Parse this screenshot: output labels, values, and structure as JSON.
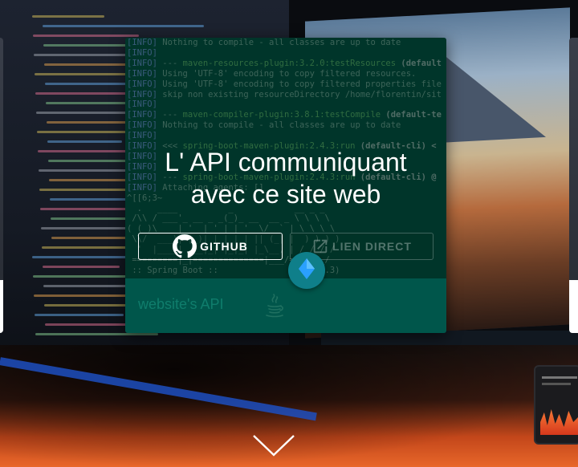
{
  "hero": {
    "title_line1": "L' API communiquant",
    "title_line2": "avec ce site web"
  },
  "card": {
    "terminal_lines": [
      {
        "tag": "[INFO]",
        "text": " Nothing to compile - all classes are up to date"
      },
      {
        "tag": "[INFO]",
        "text": ""
      },
      {
        "tag": "[INFO]",
        "text": " --- ",
        "plugin": "maven-resources-plugin:3.2.0:testResources",
        "goal": " (default"
      },
      {
        "tag": "[INFO]",
        "text": " Using 'UTF-8' encoding to copy filtered resources."
      },
      {
        "tag": "[INFO]",
        "text": " Using 'UTF-8' encoding to copy filtered properties file"
      },
      {
        "tag": "[INFO]",
        "text": " skip non existing resourceDirectory /home/florentin/sit"
      },
      {
        "tag": "[INFO]",
        "text": ""
      },
      {
        "tag": "[INFO]",
        "text": " --- ",
        "plugin": "maven-compiler-plugin:3.8.1:testCompile",
        "goal": " (default-te"
      },
      {
        "tag": "[INFO]",
        "text": " Nothing to compile - all classes are up to date"
      },
      {
        "tag": "[INFO]",
        "text": ""
      },
      {
        "tag": "[INFO]",
        "text": " <<< ",
        "plugin": "spring-boot-maven-plugin:2.4.3:run",
        "goal": " (default-cli) <"
      },
      {
        "tag": "[INFO]",
        "text": ""
      },
      {
        "tag": "[INFO]",
        "text": ""
      },
      {
        "tag": "[INFO]",
        "text": " --- ",
        "plugin": "spring-boot-maven-plugin:2.4.3:run",
        "goal": " (default-cli) @"
      },
      {
        "tag": "[INFO]",
        "text": " Attaching agents: []"
      },
      {
        "tag": "",
        "text": "^[[6;3~"
      },
      {
        "tag": "",
        "text": "  .   ____          _            __ _ _"
      },
      {
        "tag": "",
        "text": " /\\\\ / ___'_ __ _ _(_)_ __  __ _ \\ \\ \\ \\"
      },
      {
        "tag": "",
        "text": "( ( )\\___ | '_ | '_| | '_ \\/ _` | \\ \\ \\ \\"
      },
      {
        "tag": "",
        "text": " \\\\/  ___)| |_)| | | | | || (_| |  ) ) ) )"
      },
      {
        "tag": "",
        "text": "  '  |____| .__|_| |_|_| |_\\__, | / / / /"
      },
      {
        "tag": "",
        "text": " =========|_|==============|___/=/_/_/_/"
      },
      {
        "tag": "",
        "text": " :: Spring Boot ::                (v2.4.3)"
      }
    ],
    "github_label": "GITHUB",
    "direct_label": "LIEN DIRECT",
    "footer_label": "website's API"
  },
  "icons": {
    "github": "github-icon",
    "external_link": "external-link-icon",
    "java": "java-icon",
    "diamond": "diamond-icon",
    "scroll_down": "chevron-down-icon"
  },
  "colors": {
    "terminal_bg": "#00372c",
    "footer_bg": "#00564b",
    "footer_text": "#0f7d6c",
    "fab": "#0f7f8a",
    "fab_icon": "#2aa0ff"
  }
}
